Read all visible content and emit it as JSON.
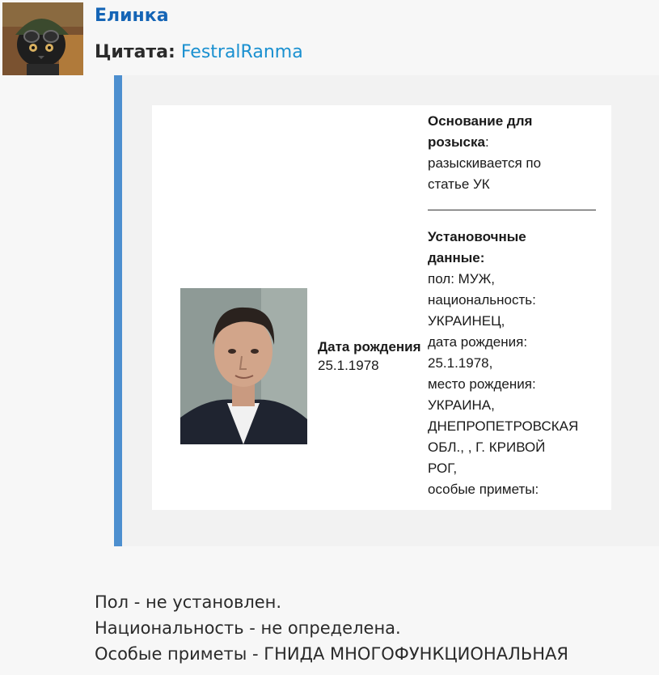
{
  "post": {
    "username": "Елинка",
    "quote_label": "Цитата:",
    "quote_author": "FestralRanma",
    "avatar_icon": "cat-in-helmet-avatar"
  },
  "card": {
    "photo_icon": "portrait-photo",
    "dob_label": "Дата рождения",
    "dob_value": "25.1.1978",
    "basis_heading_1": "Основание для",
    "basis_heading_2": "розыска",
    "basis_colon": ":",
    "basis_text_1": "разыскивается по",
    "basis_text_2": "статье УК",
    "data_heading_1": "Установочные",
    "data_heading_2": "данные:",
    "lines": [
      "пол: МУЖ,",
      "национальность:",
      "УКРАИНЕЦ,",
      "дата рождения:",
      "25.1.1978,",
      "место рождения:",
      "УКРАИНА,",
      "ДНЕПРОПЕТРОВСКАЯ",
      "ОБЛ., , Г. КРИВОЙ",
      "РОГ,",
      "особые приметы:"
    ]
  },
  "reply": {
    "lines": [
      "Пол - не установлен.",
      "Национальность - не определена.",
      "Особые приметы - ГНИДА МНОГОФУНКЦИОНАЛЬНАЯ"
    ]
  },
  "colors": {
    "username": "#1565b6",
    "quote_author": "#1a90d0",
    "quote_bar": "#4d8fcf"
  }
}
